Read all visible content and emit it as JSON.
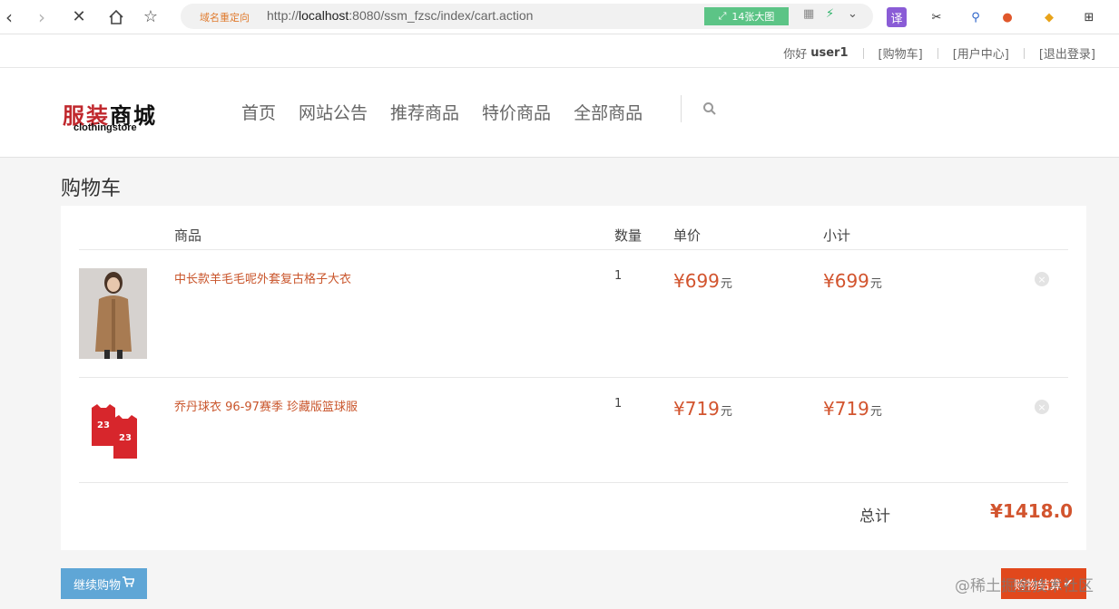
{
  "browser": {
    "redirect_label": "域名重定向",
    "url_prefix": "http://",
    "url_host": "localhost",
    "url_rest": ":8080/ssm_fzsc/index/cart.action",
    "bigimage_label": "14张大图",
    "translate_label": "译"
  },
  "userbar": {
    "greeting": "你好",
    "username": "user1",
    "cart_link": "[购物车]",
    "usercenter_link": "[用户中心]",
    "logout_link": "[退出登录]"
  },
  "logo": {
    "cn_part1": "服装",
    "cn_part2": "商城",
    "en": "clothingstore"
  },
  "nav": [
    "首页",
    "网站公告",
    "推荐商品",
    "特价商品",
    "全部商品"
  ],
  "page": {
    "title": "购物车"
  },
  "cart": {
    "headers": {
      "product": "商品",
      "qty": "数量",
      "unit_price": "单价",
      "subtotal": "小计"
    },
    "items": [
      {
        "name": "中长款羊毛毛呢外套复古格子大衣",
        "qty": "1",
        "price": "¥699",
        "subtotal": "¥699",
        "unit": "元"
      },
      {
        "name": "乔丹球衣 96-97赛季 珍藏版篮球服",
        "qty": "1",
        "price": "¥719",
        "subtotal": "¥719",
        "unit": "元"
      }
    ],
    "total_label": "总计",
    "total_value": "¥1418.0"
  },
  "buttons": {
    "continue_label": "继续购物",
    "checkout_label": "购物结算"
  },
  "watermark": "@稀土掘金技术社区",
  "colors": {
    "accent": "#d2542e",
    "continue_button": "#5fa6d6",
    "checkout_button": "#e1481c"
  }
}
